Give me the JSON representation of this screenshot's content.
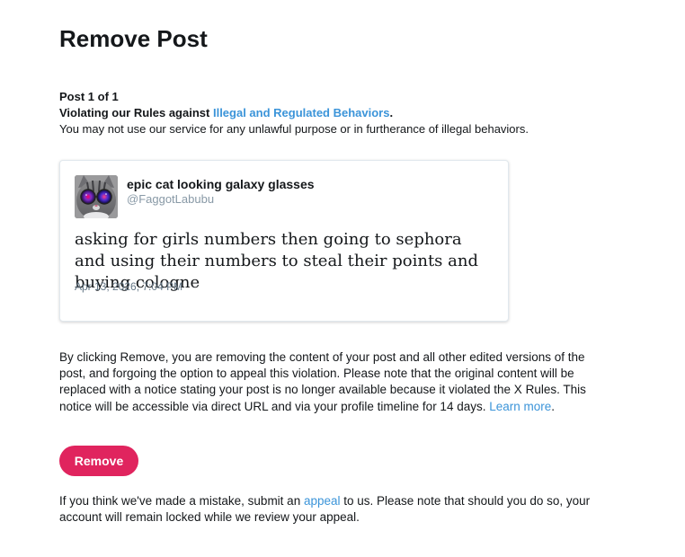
{
  "page": {
    "title": "Remove Post"
  },
  "intro": {
    "post_count": "Post 1 of 1",
    "violation_prefix": "Violating our Rules against ",
    "violation_link": "Illegal and Regulated Behaviors",
    "violation_suffix": ".",
    "description": "You may not use our service for any unlawful purpose or in furtherance of illegal behaviors."
  },
  "post": {
    "display_name": "epic cat looking galaxy glasses",
    "handle": "@FaggotLabubu",
    "text": "asking for girls numbers then going to sephora and using their numbers to steal their points and buying cologne",
    "timestamp": "Apr 13, 2026, 7:04 PM",
    "avatar_icon": "cat-with-galaxy-glasses-avatar"
  },
  "disclaimer": {
    "text": "By clicking Remove, you are removing the content of your post and all other edited versions of the post, and forgoing the option to appeal this violation. Please note that the original content will be replaced with a notice stating your post is no longer available because it violated the X Rules. This notice will be accessible via direct URL and via your profile timeline for 14 days.",
    "learn_more": "Learn more",
    "learn_more_suffix": "."
  },
  "actions": {
    "remove_label": "Remove"
  },
  "footer": {
    "prefix": "If you think we've made a mistake, submit an ",
    "appeal_link": "appeal",
    "suffix": " to us. Please note that should you do so, your account will remain locked while we review your appeal."
  },
  "colors": {
    "accent_link": "#3b94d9",
    "remove_button": "#e0245e",
    "muted_text": "#657786"
  }
}
